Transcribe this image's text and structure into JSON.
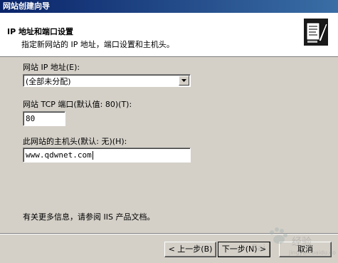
{
  "window": {
    "title": "网站创建向导"
  },
  "header": {
    "title": "IP 地址和端口设置",
    "subtitle": "指定新网站的 IP 地址，端口设置和主机头。",
    "icon": "web-server-wizard-icon"
  },
  "fields": {
    "ip_label": "网站 IP 地址(E):",
    "ip_value": "(全部未分配)",
    "port_label": "网站 TCP 端口(默认值: 80)(T):",
    "port_value": "80",
    "host_label": "此网站的主机头(默认: 无)(H):",
    "host_value": "www.qdwnet.com"
  },
  "footer": {
    "info": "有关更多信息，请参阅 IIS 产品文档。"
  },
  "buttons": {
    "back": "< 上一步(B)",
    "next": "下一步(N) >",
    "cancel": "取消"
  }
}
